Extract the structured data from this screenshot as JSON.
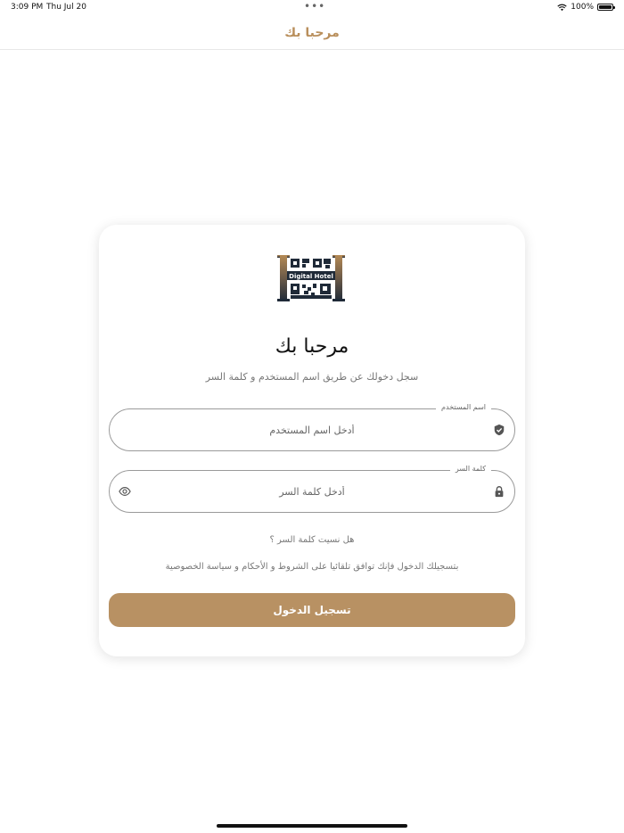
{
  "status_bar": {
    "time": "3:09 PM",
    "date": "Thu Jul 20",
    "battery": "100%",
    "wifi_icon": "wifi-icon"
  },
  "nav": {
    "title": "مرحبا بك"
  },
  "logo": {
    "text": "Digital Hotel"
  },
  "card": {
    "welcome": "مرحبا بك",
    "subtitle": "سجل دخولك عن طريق اسم المستخدم و كلمة السر",
    "username": {
      "label": "اسم المستخدم",
      "placeholder": "أدخل اسم المستخدم",
      "value": "",
      "icon": "shield-check-icon"
    },
    "password": {
      "label": "كلمة السر",
      "placeholder": "أدخل كلمة السر",
      "value": "",
      "icon": "lock-icon",
      "toggle_icon": "eye-icon"
    },
    "forgot": "هل نسيت كلمة السر ؟",
    "terms": "بتسجيلك الدخول فإنك توافق تلقائيا على الشروط و الأحكام و سياسة الخصوصية",
    "login_button": "تسجيل الدخول"
  },
  "colors": {
    "accent": "#b89163",
    "nav_title": "#b98f5c",
    "logo_dark": "#1f2a38",
    "logo_gold": "#b58a55"
  }
}
